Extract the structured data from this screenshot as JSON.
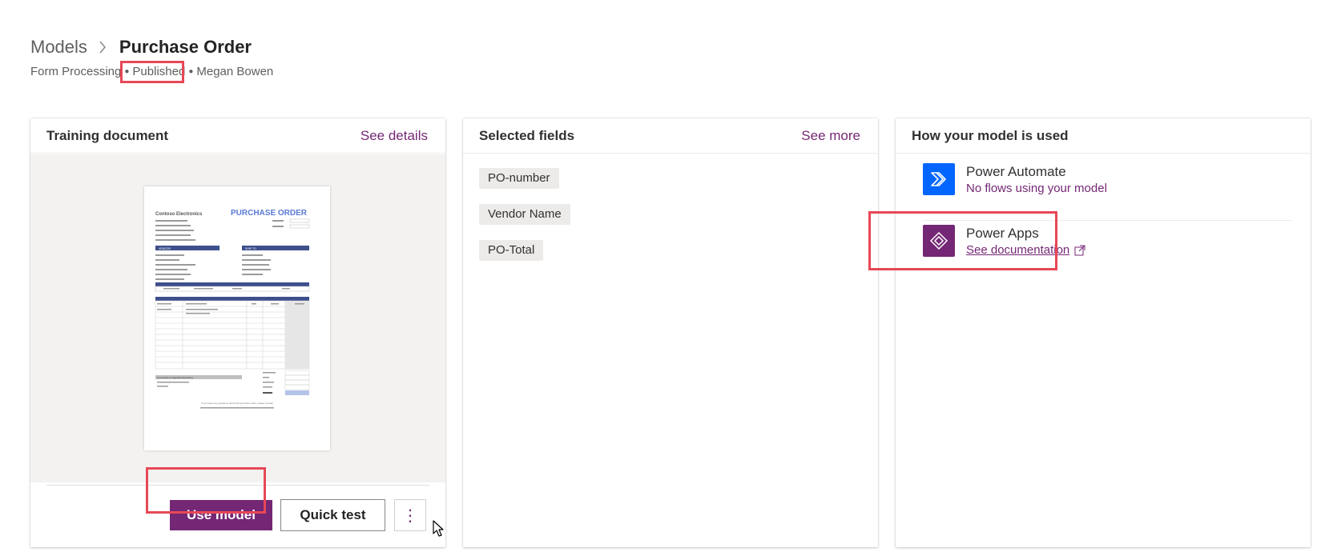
{
  "breadcrumb": {
    "root": "Models",
    "current": "Purchase Order"
  },
  "meta": {
    "type": "Form Processing",
    "status": "Published",
    "owner": "Megan Bowen"
  },
  "training_card": {
    "title": "Training document",
    "link": "See details",
    "buttons": {
      "use_model": "Use model",
      "quick_test": "Quick test",
      "more": "⋮"
    },
    "document": {
      "company": "Contoso Electronics",
      "heading": "PURCHASE ORDER",
      "address_lines": [
        "5807 180th Ave NE",
        "Redmond, WA 98008",
        "Phone: 1 (800) 000-7970",
        "Fax: 1 (800) 000-7970",
        "Website: www.contoso.com"
      ],
      "vendor_label": "VENDOR",
      "ship_to_label": "SHIP TO",
      "shipping_headers": [
        "REQUISITIONER",
        "SHIP VIA",
        "F.O.B.",
        "SHIPPING TERMS"
      ],
      "item_headers": [
        "ITEM #",
        "DESCRIPTION",
        "QTY",
        "UNIT PRICE",
        "TOTAL"
      ],
      "comments_label": "Comments or Special Instructions",
      "totals_labels": [
        "SUBTOTAL",
        "TAX",
        "SHIPPING",
        "OTHER",
        "TOTAL"
      ],
      "footer": "If you have any questions about this purchase order, please contact"
    }
  },
  "fields_card": {
    "title": "Selected fields",
    "link": "See more",
    "fields": [
      "PO-number",
      "Vendor Name",
      "PO-Total"
    ]
  },
  "usage_card": {
    "title": "How your model is used",
    "items": [
      {
        "name": "Power Automate",
        "sub": "No flows using your model",
        "icon": "power-automate-icon",
        "color": "#0066ff"
      },
      {
        "name": "Power Apps",
        "sub": "See documentation",
        "icon": "power-apps-icon",
        "color": "#742774"
      }
    ]
  },
  "colors": {
    "accent": "#742774",
    "highlight": "#e74856",
    "automate": "#0066ff"
  }
}
